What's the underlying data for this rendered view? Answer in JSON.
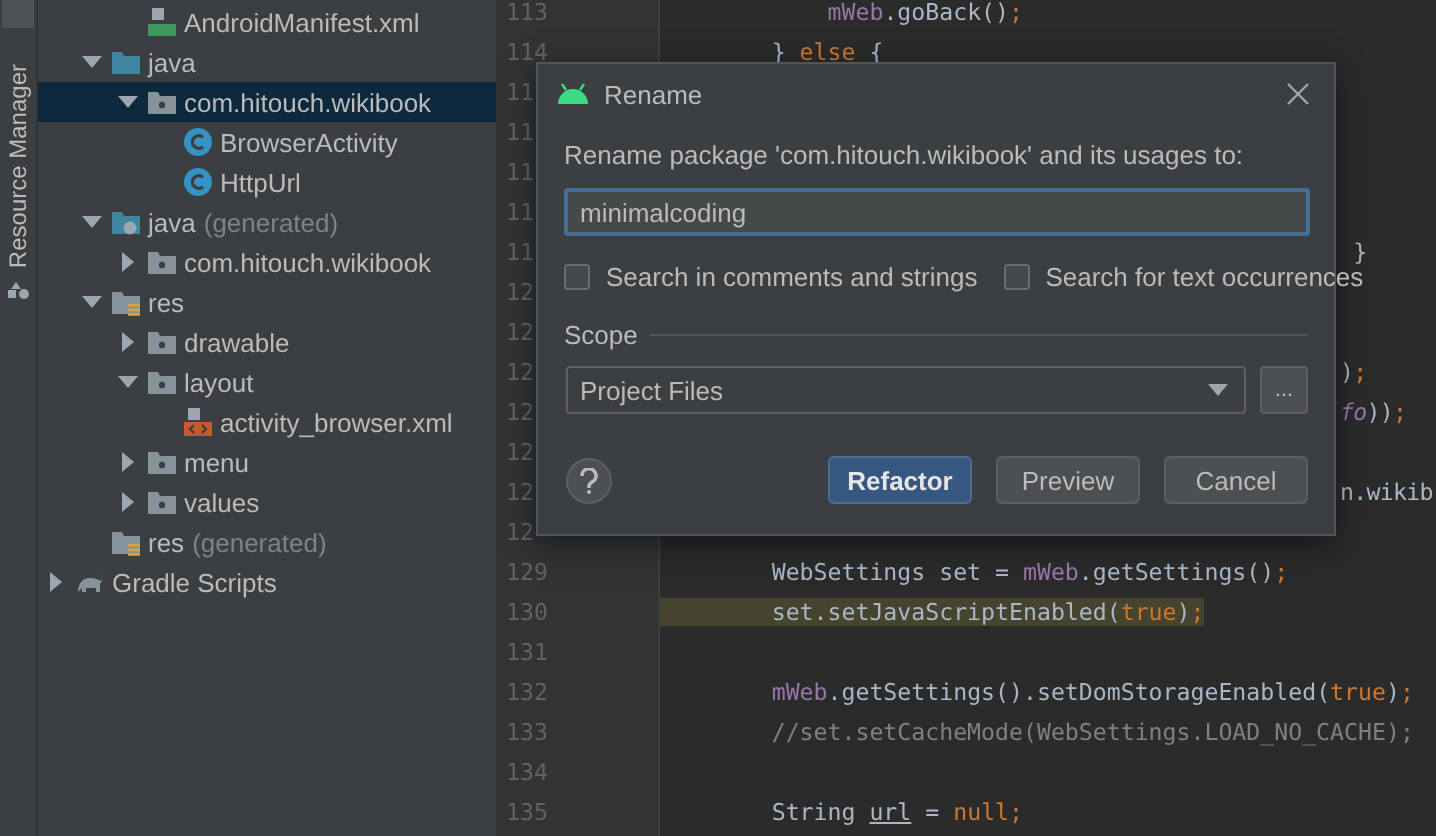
{
  "tool_strip": {
    "label": "Resource Manager"
  },
  "tree": [
    {
      "children": [
        {
          "children": [
            {
              "label": "AndroidManifest.xml",
              "kind": "manifest",
              "selected": false
            }
          ]
        },
        {
          "label": "java",
          "kind": "src",
          "expanded": true,
          "selected": false,
          "children": [
            {
              "label": "com.hitouch.wikibook",
              "kind": "package",
              "expanded": true,
              "selected": true,
              "children": [
                {
                  "label": "BrowserActivity",
                  "kind": "class",
                  "selected": false
                },
                {
                  "label": "HttpUrl",
                  "kind": "class",
                  "selected": false
                }
              ]
            }
          ]
        },
        {
          "label": "java",
          "suffix": "(generated)",
          "kind": "gen",
          "expanded": true,
          "selected": false,
          "children": [
            {
              "label": "com.hitouch.wikibook",
              "kind": "package",
              "expanded": false,
              "selected": false
            }
          ]
        },
        {
          "label": "res",
          "kind": "res",
          "expanded": true,
          "selected": false,
          "children": [
            {
              "label": "drawable",
              "kind": "package",
              "expanded": false,
              "selected": false
            },
            {
              "label": "layout",
              "kind": "package",
              "expanded": true,
              "selected": false,
              "children": [
                {
                  "label": "activity_browser.xml",
                  "kind": "xml",
                  "selected": false
                }
              ]
            },
            {
              "label": "menu",
              "kind": "package",
              "expanded": false,
              "selected": false
            },
            {
              "label": "values",
              "kind": "package",
              "expanded": false,
              "selected": false
            }
          ]
        },
        {
          "label": "res",
          "suffix": "(generated)",
          "kind": "res",
          "selected": false
        }
      ]
    },
    {
      "label": "Gradle Scripts",
      "kind": "gradle",
      "expanded": false,
      "selected": false
    }
  ],
  "editor": {
    "lines": [
      {
        "number": "113",
        "kind": "code",
        "tokens": [
          {
            "text": "            mWeb",
            "kind": "field"
          },
          {
            "text": ".goBack()",
            "kind": "plain"
          },
          {
            "text": ";",
            "kind": "keyword"
          }
        ]
      },
      {
        "number": "114",
        "kind": "code",
        "tokens": [
          {
            "text": "        }",
            "kind": "plain"
          },
          {
            "text": " else ",
            "kind": "keyword"
          },
          {
            "text": "{",
            "kind": "plain"
          }
        ]
      },
      {
        "number": "11",
        "kind": "covered"
      },
      {
        "number": "11",
        "kind": "covered"
      },
      {
        "number": "11",
        "kind": "covered"
      },
      {
        "number": "11",
        "kind": "covered"
      },
      {
        "number": "11",
        "kind": "covered",
        "tokens": [
          {
            "text": " }",
            "kind": "plain"
          }
        ]
      },
      {
        "number": "12",
        "kind": "covered"
      },
      {
        "number": "12",
        "kind": "covered"
      },
      {
        "number": "12",
        "kind": "covered",
        "tokens": [
          {
            "text": ")",
            "kind": "plain"
          },
          {
            "text": ";",
            "kind": "keyword"
          }
        ]
      },
      {
        "number": "12",
        "kind": "covered",
        "tokens": [
          {
            "text": "fo",
            "kind": "static"
          },
          {
            "text": "))",
            "kind": "plain"
          },
          {
            "text": ";",
            "kind": "keyword"
          }
        ]
      },
      {
        "number": "12",
        "kind": "covered"
      },
      {
        "number": "12",
        "kind": "covered",
        "tokens": [
          {
            "text": "n.wikib",
            "kind": "plain"
          }
        ]
      },
      {
        "number": "12",
        "kind": "covered"
      },
      {
        "number": "129",
        "kind": "code",
        "tokens": [
          {
            "text": "        WebSettings set = ",
            "kind": "plain"
          },
          {
            "text": "mWeb",
            "kind": "field"
          },
          {
            "text": ".getSettings()",
            "kind": "plain"
          },
          {
            "text": ";",
            "kind": "keyword"
          }
        ]
      },
      {
        "number": "130",
        "kind": "code",
        "highlighted": true,
        "tokens": [
          {
            "text": "        set.setJavaScriptEnabled(",
            "kind": "plain"
          },
          {
            "text": "true",
            "kind": "keyword"
          },
          {
            "text": ")",
            "kind": "plain"
          },
          {
            "text": ";",
            "kind": "keyword"
          }
        ]
      },
      {
        "number": "131",
        "kind": "code"
      },
      {
        "number": "132",
        "kind": "code",
        "tokens": [
          {
            "text": "        mWeb",
            "kind": "field"
          },
          {
            "text": ".getSettings().setDomStorageEnabled(",
            "kind": "plain"
          },
          {
            "text": "true",
            "kind": "keyword"
          },
          {
            "text": ")",
            "kind": "plain"
          },
          {
            "text": ";",
            "kind": "keyword"
          }
        ]
      },
      {
        "number": "133",
        "kind": "code",
        "tokens": [
          {
            "text": "        //set.setCacheMode(WebSettings.LOAD_NO_CACHE);",
            "kind": "comment"
          }
        ]
      },
      {
        "number": "134",
        "kind": "code"
      },
      {
        "number": "135",
        "kind": "code",
        "tokens": [
          {
            "text": "        String ",
            "kind": "plain"
          },
          {
            "text": "url",
            "kind": "local"
          },
          {
            "text": " = ",
            "kind": "plain"
          },
          {
            "text": "null",
            "kind": "keyword"
          },
          {
            "text": ";",
            "kind": "keyword"
          }
        ]
      }
    ]
  },
  "dialog": {
    "title": "Rename",
    "prompt": "Rename package 'com.hitouch.wikibook' and its usages to:",
    "value": "minimalcoding",
    "options": [
      {
        "label": "Search in comments and strings",
        "checked": false
      },
      {
        "label": "Search for text occurrences",
        "checked": false
      }
    ],
    "scope_label": "Scope",
    "scope": "Project Files",
    "browse": "...",
    "buttons": [
      {
        "label": "Refactor",
        "kind": "primary"
      },
      {
        "label": "Preview",
        "kind": "normal"
      },
      {
        "label": "Cancel",
        "kind": "normal"
      }
    ]
  }
}
